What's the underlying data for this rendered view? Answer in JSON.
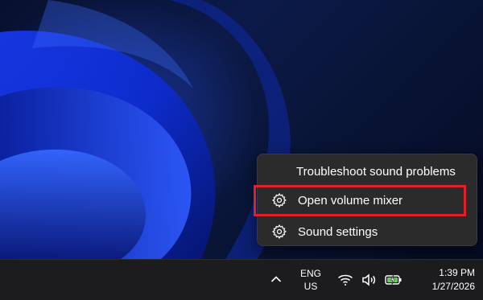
{
  "context_menu": {
    "items": [
      {
        "label": "Troubleshoot sound problems",
        "icon": null
      },
      {
        "label": "Open volume mixer",
        "icon": "gear-icon",
        "highlighted": true
      },
      {
        "label": "Sound settings",
        "icon": "gear-icon"
      }
    ],
    "highlight_color": "#e0202a"
  },
  "taskbar": {
    "overflow_icon": "chevron-up-icon",
    "language": {
      "line1": "ENG",
      "line2": "US"
    },
    "tray_icons": [
      "wifi-icon",
      "speaker-icon",
      "battery-charging-icon"
    ],
    "clock": {
      "time": "1:39 PM",
      "date": "1/27/2026"
    }
  },
  "colors": {
    "battery_accent": "#6ccb5f",
    "menu_bg": "#2b2b2b",
    "taskbar_bg": "#1c1c1f"
  }
}
